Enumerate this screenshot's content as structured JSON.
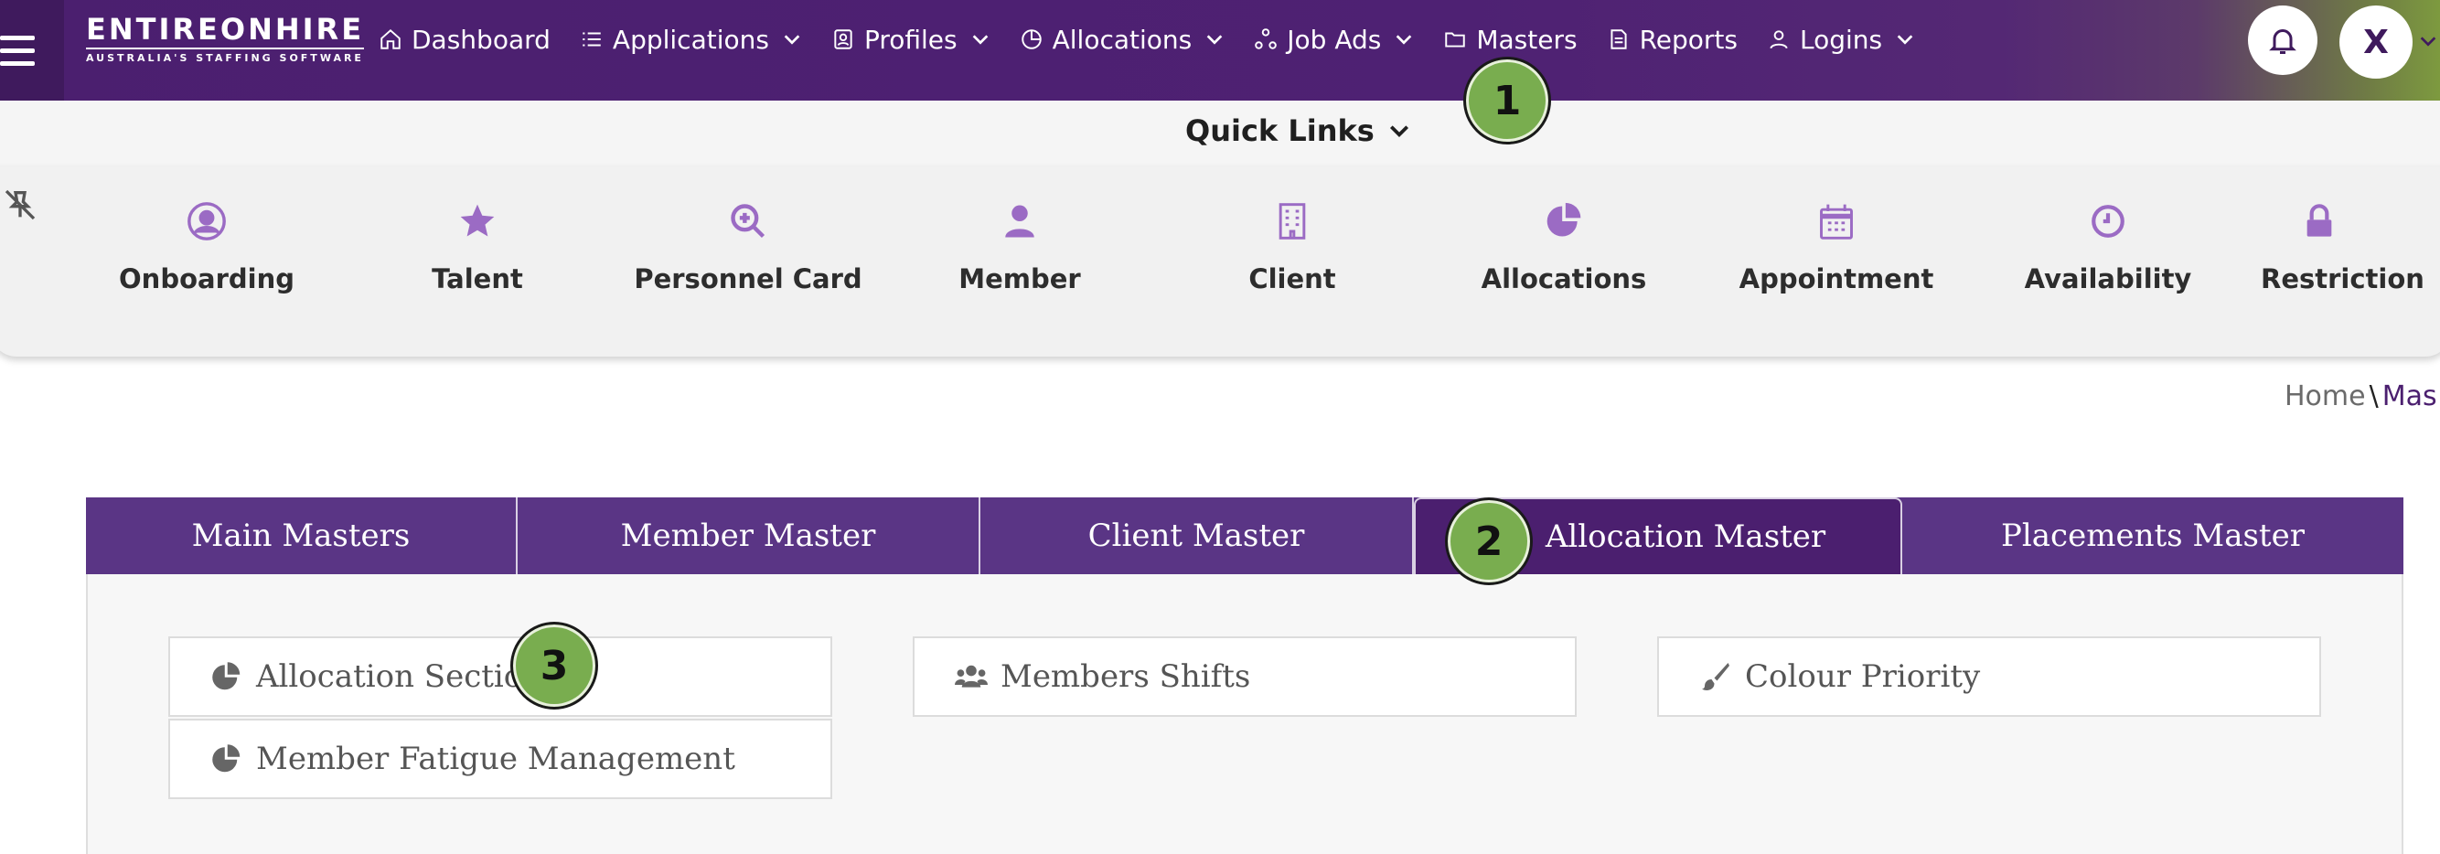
{
  "brand": {
    "logo_text": "ENTIREONHIRE",
    "logo_tagline": "AUSTRALIA'S STAFFING SOFTWARE"
  },
  "nav": {
    "items": [
      {
        "label": "Dashboard",
        "icon": "home-icon",
        "dropdown": false
      },
      {
        "label": "Applications",
        "icon": "list-icon",
        "dropdown": true
      },
      {
        "label": "Profiles",
        "icon": "id-badge-icon",
        "dropdown": true
      },
      {
        "label": "Allocations",
        "icon": "pie-icon",
        "dropdown": true
      },
      {
        "label": "Job Ads",
        "icon": "network-icon",
        "dropdown": true
      },
      {
        "label": "Masters",
        "icon": "folder-icon",
        "dropdown": false
      },
      {
        "label": "Reports",
        "icon": "document-icon",
        "dropdown": false
      },
      {
        "label": "Logins",
        "icon": "user-icon",
        "dropdown": true
      }
    ],
    "avatar_initial": "X"
  },
  "quick_links": {
    "title": "Quick Links",
    "items": [
      {
        "label": "Onboarding",
        "icon": "user-circle-icon"
      },
      {
        "label": "Talent",
        "icon": "star-icon"
      },
      {
        "label": "Personnel Card",
        "icon": "search-plus-icon"
      },
      {
        "label": "Member",
        "icon": "user-icon"
      },
      {
        "label": "Client",
        "icon": "building-icon"
      },
      {
        "label": "Allocations",
        "icon": "pie-chart-icon"
      },
      {
        "label": "Appointment",
        "icon": "calendar-icon"
      },
      {
        "label": "Availability",
        "icon": "clock-icon"
      },
      {
        "label": "Restriction",
        "icon": "lock-icon"
      }
    ]
  },
  "breadcrumb": {
    "home": "Home",
    "separator": "\\",
    "current": "Mas"
  },
  "tabs": [
    {
      "label": "Main Masters",
      "active": false
    },
    {
      "label": "Member Master",
      "active": false
    },
    {
      "label": "Client Master",
      "active": false
    },
    {
      "label": "Allocation Master",
      "active": true
    },
    {
      "label": "Placements Master",
      "active": false
    }
  ],
  "masters": [
    {
      "label": "Allocation Sections",
      "icon": "pie-chart-icon"
    },
    {
      "label": "Members Shifts",
      "icon": "users-icon"
    },
    {
      "label": "Colour Priority",
      "icon": "paint-brush-icon"
    },
    {
      "label": "Member Fatigue Management",
      "icon": "pie-chart-icon"
    }
  ],
  "markers": [
    "1",
    "2",
    "3"
  ],
  "colors": {
    "nav_bg": "#4e2173",
    "tab_bg": "#5a3585",
    "tab_active_bg": "#4b1f6f",
    "accent_icon": "#9b6bc4",
    "marker_green": "#79ad4f"
  }
}
